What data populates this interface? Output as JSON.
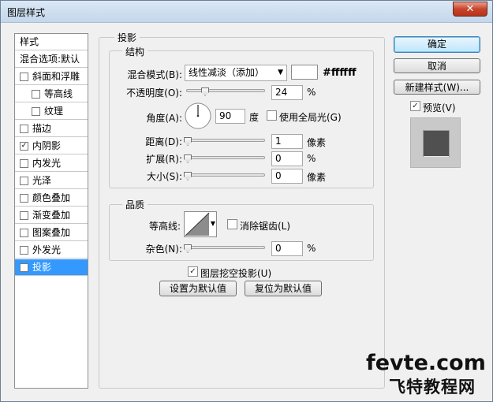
{
  "window": {
    "title": "图层样式",
    "close": "✕"
  },
  "left_list": {
    "header": "样式",
    "blend_default": "混合选项:默认",
    "items": [
      {
        "label": "斜面和浮雕",
        "checked": false
      },
      {
        "label": "等高线",
        "checked": false
      },
      {
        "label": "纹理",
        "checked": false
      },
      {
        "label": "描边",
        "checked": false
      },
      {
        "label": "内阴影",
        "checked": true
      },
      {
        "label": "内发光",
        "checked": false
      },
      {
        "label": "光泽",
        "checked": false
      },
      {
        "label": "颜色叠加",
        "checked": false
      },
      {
        "label": "渐变叠加",
        "checked": false
      },
      {
        "label": "图案叠加",
        "checked": false
      },
      {
        "label": "外发光",
        "checked": false
      },
      {
        "label": "投影",
        "checked": true
      }
    ]
  },
  "shadow": {
    "title": "投影",
    "structure": {
      "title": "结构",
      "blend_mode_label": "混合模式(B):",
      "blend_mode_value": "线性减淡（添加）",
      "color_hex": "#ffffff",
      "opacity_label": "不透明度(O):",
      "opacity_value": "24",
      "opacity_unit": "%",
      "angle_label": "角度(A):",
      "angle_value": "90",
      "angle_unit": "度",
      "global_light_label": "使用全局光(G)",
      "global_light_checked": false,
      "distance_label": "距离(D):",
      "distance_value": "1",
      "distance_unit": "像素",
      "spread_label": "扩展(R):",
      "spread_value": "0",
      "spread_unit": "%",
      "size_label": "大小(S):",
      "size_value": "0",
      "size_unit": "像素"
    },
    "quality": {
      "title": "品质",
      "contour_label": "等高线:",
      "antialias_label": "消除锯齿(L)",
      "antialias_checked": false,
      "noise_label": "杂色(N):",
      "noise_value": "0",
      "noise_unit": "%"
    },
    "knockout_label": "图层挖空投影(U)",
    "knockout_checked": true,
    "set_default": "设置为默认值",
    "reset_default": "复位为默认值"
  },
  "buttons": {
    "ok": "确定",
    "cancel": "取消",
    "new_style": "新建样式(W)...",
    "preview_label": "预览(V)",
    "preview_checked": true
  },
  "watermark": {
    "line1": "fevte.com",
    "line2": "飞特教程网"
  },
  "check_glyph": "✓",
  "arrow_glyph": "▼"
}
